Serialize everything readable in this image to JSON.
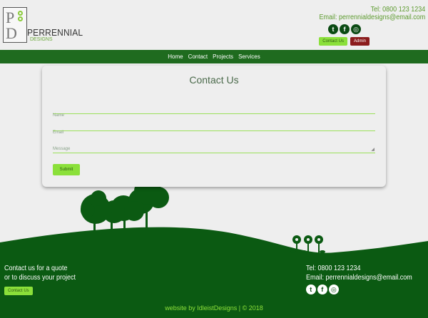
{
  "header": {
    "logo": {
      "mark": "PD",
      "name": "PERRENNIAL",
      "tag": "DESIGNS"
    },
    "tel": "Tel: 0800 123 1234",
    "email": "Email: perrennialdesigns@email.com",
    "social_icons": [
      "twitter-icon",
      "facebook-icon",
      "instagram-icon"
    ],
    "contact_button": "Contact Us",
    "admin_button": "Admin"
  },
  "nav": {
    "items": [
      "Home",
      "Contact",
      "Projects",
      "Services"
    ]
  },
  "form": {
    "title": "Contact Us",
    "name_label": "Name",
    "email_label": "Email",
    "message_label": "Message",
    "submit_label": "Submit"
  },
  "footer": {
    "quote_line1": "Contact us for a quote",
    "quote_line2": "or to discuss your project",
    "contact_button": "Contact Us",
    "tel": "Tel: 0800 123 1234",
    "email": "Email: perrennialdesigns@email.com",
    "credit": "website by IdleistDesigns | © 2018"
  },
  "colors": {
    "nav_bg": "#1f6b1f",
    "hill": "#0b5a12",
    "accent_green": "#8be03a",
    "admin_red": "#8b1c1c",
    "page_bg": "#eeeeee"
  }
}
